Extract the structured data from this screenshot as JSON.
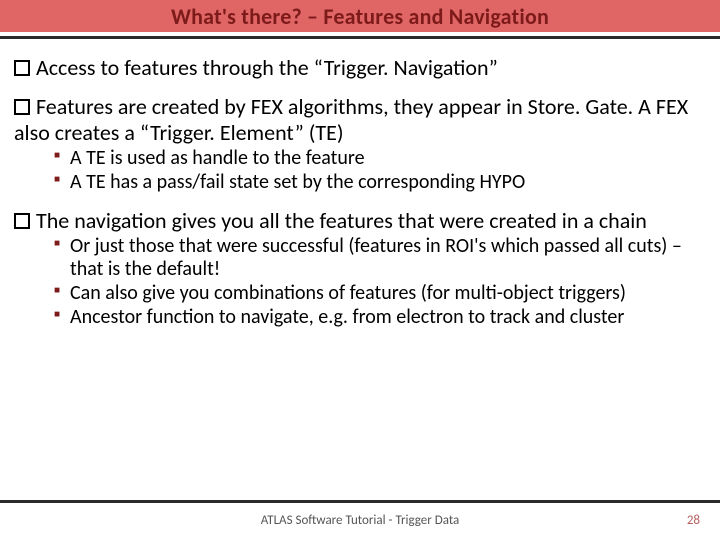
{
  "title": "What's there? – Features and Navigation",
  "bullets": [
    {
      "text": "Access to features through the “Trigger. Navigation”",
      "subs": []
    },
    {
      "text": "Features are created by FEX algorithms, they appear in Store. Gate. A FEX also creates a “Trigger. Element” (TE)",
      "subs": [
        "A TE is used as handle to the feature",
        "A TE has a pass/fail state set by the corresponding HYPO"
      ]
    },
    {
      "text": "The navigation gives you all the features that were created in a chain",
      "subs": [
        "Or just those that were successful (features in ROI's which passed all cuts) – that is the default!",
        "Can also give you combinations of features (for multi-object triggers)",
        "Ancestor function to navigate, e.g. from electron to track and cluster"
      ]
    }
  ],
  "footer": {
    "center": "ATLAS Software Tutorial - Trigger Data",
    "page": "28"
  }
}
